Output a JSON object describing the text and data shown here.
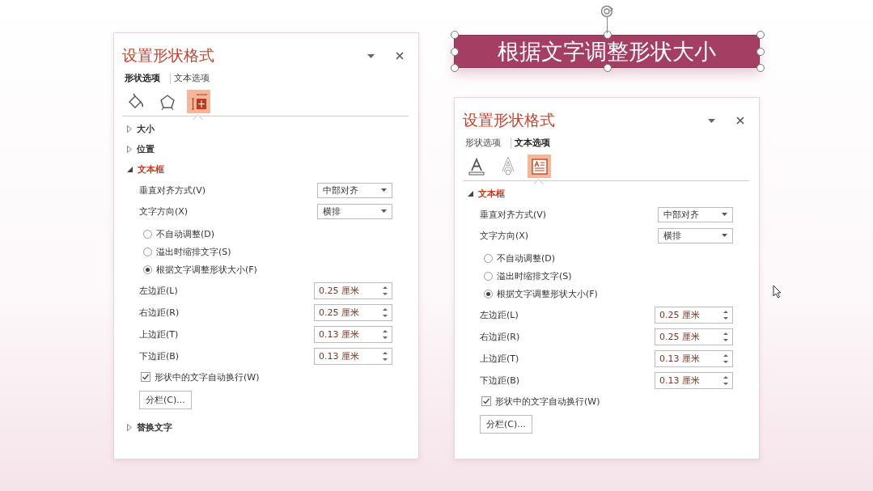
{
  "slide_shape": {
    "text": "根据文字调整形状大小",
    "selected": true
  },
  "panels": [
    {
      "title": "设置形状格式",
      "tabs": [
        {
          "label": "形状选项",
          "selected": true
        },
        {
          "label": "文本选项",
          "selected": false
        }
      ],
      "icon_tabs": [
        {
          "kind": "fill",
          "selected": false
        },
        {
          "kind": "effects",
          "selected": false
        },
        {
          "kind": "layout",
          "selected": true
        }
      ],
      "sections": [
        {
          "title": "大小",
          "expanded": false
        },
        {
          "title": "位置",
          "expanded": false
        },
        {
          "title": "文本框",
          "expanded": true,
          "content": {
            "dropdowns": [
              {
                "label": "垂直对齐方式(V)",
                "value": "中部对齐"
              },
              {
                "label": "文字方向(X)",
                "value": "横排"
              }
            ],
            "radios": [
              {
                "label": "不自动调整(D)",
                "selected": false
              },
              {
                "label": "溢出时缩排文字(S)",
                "selected": false
              },
              {
                "label": "根据文字调整形状大小(F)",
                "selected": true
              }
            ],
            "spinners": [
              {
                "label": "左边距(L)",
                "value": "0.25 厘米"
              },
              {
                "label": "右边距(R)",
                "value": "0.25 厘米"
              },
              {
                "label": "上边距(T)",
                "value": "0.13 厘米"
              },
              {
                "label": "下边距(B)",
                "value": "0.13 厘米"
              }
            ],
            "checkbox": {
              "label": "形状中的文字自动换行(W)",
              "checked": true
            },
            "button": "分栏(C)..."
          }
        },
        {
          "title": "替换文字",
          "expanded": false
        }
      ]
    },
    {
      "title": "设置形状格式",
      "tabs": [
        {
          "label": "形状选项",
          "selected": false
        },
        {
          "label": "文本选项",
          "selected": true
        }
      ],
      "icon_tabs": [
        {
          "kind": "text-fill",
          "selected": false
        },
        {
          "kind": "text-outline",
          "selected": false
        },
        {
          "kind": "textbox",
          "selected": true
        }
      ],
      "sections": [
        {
          "title": "文本框",
          "expanded": true,
          "content": {
            "dropdowns": [
              {
                "label": "垂直对齐方式(V)",
                "value": "中部对齐"
              },
              {
                "label": "文字方向(X)",
                "value": "横排"
              }
            ],
            "radios": [
              {
                "label": "不自动调整(D)",
                "selected": false
              },
              {
                "label": "溢出时缩排文字(S)",
                "selected": false
              },
              {
                "label": "根据文字调整形状大小(F)",
                "selected": true
              }
            ],
            "spinners": [
              {
                "label": "左边距(L)",
                "value": "0.25 厘米"
              },
              {
                "label": "右边距(R)",
                "value": "0.25 厘米"
              },
              {
                "label": "上边距(T)",
                "value": "0.13 厘米"
              },
              {
                "label": "下边距(B)",
                "value": "0.13 厘米"
              }
            ],
            "checkbox": {
              "label": "形状中的文字自动换行(W)",
              "checked": true
            },
            "button": "分栏(C)..."
          }
        }
      ]
    }
  ]
}
